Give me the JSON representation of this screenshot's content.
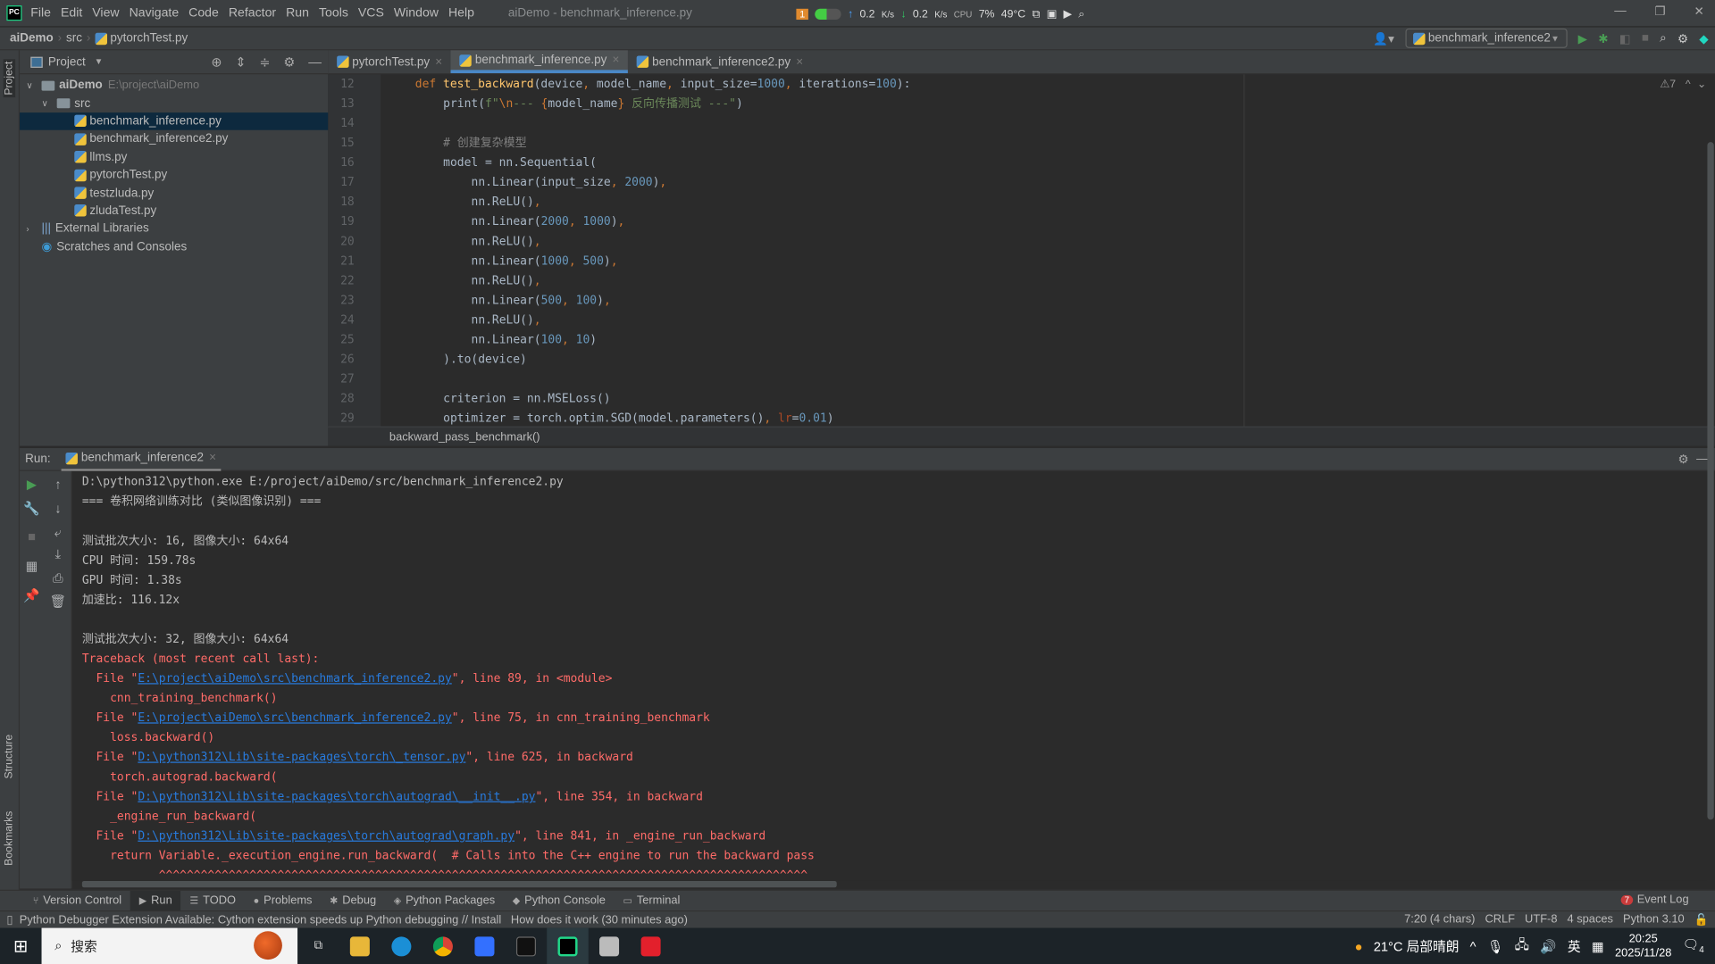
{
  "titlebar": {
    "menu": [
      "File",
      "Edit",
      "View",
      "Navigate",
      "Code",
      "Refactor",
      "Run",
      "Tools",
      "VCS",
      "Window",
      "Help"
    ],
    "title": "aiDemo - benchmark_inference.py",
    "overlay": {
      "badge": "1",
      "up": "0.2",
      "up_unit": "K/s",
      "down": "0.2",
      "down_unit": "K/s",
      "cpu_label": "CPU",
      "cpu": "7%",
      "temp": "49°C"
    }
  },
  "navbar": {
    "breadcrumb": [
      "aiDemo",
      "src",
      "pytorchTest.py"
    ],
    "run_config": "benchmark_inference2"
  },
  "project": {
    "title": "Project",
    "root": "aiDemo",
    "root_path": "E:\\project\\aiDemo",
    "src": "src",
    "files": [
      "benchmark_inference.py",
      "benchmark_inference2.py",
      "llms.py",
      "pytorchTest.py",
      "testzluda.py",
      "zludaTest.py"
    ],
    "selected": "benchmark_inference.py",
    "external": "External Libraries",
    "scratches": "Scratches and Consoles"
  },
  "tabs": [
    {
      "label": "pytorchTest.py",
      "active": false
    },
    {
      "label": "benchmark_inference.py",
      "active": true
    },
    {
      "label": "benchmark_inference2.py",
      "active": false
    }
  ],
  "editor": {
    "warnings": "7",
    "breadcrumb": "backward_pass_benchmark()",
    "lines": [
      {
        "n": "12",
        "indent": 4,
        "seg": [
          [
            "def ",
            "kw"
          ],
          [
            "test_backward",
            "fn"
          ],
          [
            "(device",
            "plain"
          ],
          [
            ", ",
            "kw"
          ],
          [
            "model_name",
            "plain"
          ],
          [
            ", ",
            "kw"
          ],
          [
            "input_size=",
            "plain"
          ],
          [
            "1000",
            "num"
          ],
          [
            ", ",
            "kw"
          ],
          [
            "iterations=",
            "plain"
          ],
          [
            "100",
            "num"
          ],
          [
            "):",
            "plain"
          ]
        ]
      },
      {
        "n": "13",
        "indent": 8,
        "seg": [
          [
            "print",
            "plain"
          ],
          [
            "(",
            "plain"
          ],
          [
            "f\"",
            "str"
          ],
          [
            "\\n",
            "esc"
          ],
          [
            "--- ",
            "str"
          ],
          [
            "{",
            "kw"
          ],
          [
            "model_name",
            "plain"
          ],
          [
            "}",
            "kw"
          ],
          [
            " 反向传播测试 ---\"",
            "str"
          ],
          [
            ")",
            "plain"
          ]
        ]
      },
      {
        "n": "14",
        "indent": 0,
        "seg": []
      },
      {
        "n": "15",
        "indent": 8,
        "seg": [
          [
            "# 创建复杂模型",
            "cm"
          ]
        ]
      },
      {
        "n": "16",
        "indent": 8,
        "seg": [
          [
            "model = nn.Sequential(",
            "plain"
          ]
        ]
      },
      {
        "n": "17",
        "indent": 12,
        "seg": [
          [
            "nn.Linear(input_size",
            "plain"
          ],
          [
            ", ",
            "kw"
          ],
          [
            "2000",
            "num"
          ],
          [
            ")",
            "plain"
          ],
          [
            ",",
            "kw"
          ]
        ]
      },
      {
        "n": "18",
        "indent": 12,
        "seg": [
          [
            "nn.ReLU()",
            "plain"
          ],
          [
            ",",
            "kw"
          ]
        ]
      },
      {
        "n": "19",
        "indent": 12,
        "seg": [
          [
            "nn.Linear(",
            "plain"
          ],
          [
            "2000",
            "num"
          ],
          [
            ", ",
            "kw"
          ],
          [
            "1000",
            "num"
          ],
          [
            ")",
            "plain"
          ],
          [
            ",",
            "kw"
          ]
        ]
      },
      {
        "n": "20",
        "indent": 12,
        "seg": [
          [
            "nn.ReLU()",
            "plain"
          ],
          [
            ",",
            "kw"
          ]
        ]
      },
      {
        "n": "21",
        "indent": 12,
        "seg": [
          [
            "nn.Linear(",
            "plain"
          ],
          [
            "1000",
            "num"
          ],
          [
            ", ",
            "kw"
          ],
          [
            "500",
            "num"
          ],
          [
            ")",
            "plain"
          ],
          [
            ",",
            "kw"
          ]
        ]
      },
      {
        "n": "22",
        "indent": 12,
        "seg": [
          [
            "nn.ReLU()",
            "plain"
          ],
          [
            ",",
            "kw"
          ]
        ]
      },
      {
        "n": "23",
        "indent": 12,
        "seg": [
          [
            "nn.Linear(",
            "plain"
          ],
          [
            "500",
            "num"
          ],
          [
            ", ",
            "kw"
          ],
          [
            "100",
            "num"
          ],
          [
            ")",
            "plain"
          ],
          [
            ",",
            "kw"
          ]
        ]
      },
      {
        "n": "24",
        "indent": 12,
        "seg": [
          [
            "nn.ReLU()",
            "plain"
          ],
          [
            ",",
            "kw"
          ]
        ]
      },
      {
        "n": "25",
        "indent": 12,
        "seg": [
          [
            "nn.Linear(",
            "plain"
          ],
          [
            "100",
            "num"
          ],
          [
            ", ",
            "kw"
          ],
          [
            "10",
            "num"
          ],
          [
            ")",
            "plain"
          ]
        ]
      },
      {
        "n": "26",
        "indent": 8,
        "seg": [
          [
            ").to(device)",
            "plain"
          ]
        ]
      },
      {
        "n": "27",
        "indent": 0,
        "seg": []
      },
      {
        "n": "28",
        "indent": 8,
        "seg": [
          [
            "criterion = nn.MSELoss()",
            "plain"
          ]
        ]
      },
      {
        "n": "29",
        "indent": 8,
        "seg": [
          [
            "optimizer = torch.optim.SGD(model.parameters()",
            "plain"
          ],
          [
            ", ",
            "kw"
          ],
          [
            "lr",
            "param"
          ],
          [
            "=",
            "plain"
          ],
          [
            "0.01",
            "num"
          ],
          [
            ")",
            "plain"
          ]
        ]
      }
    ]
  },
  "run": {
    "label": "Run:",
    "tab": "benchmark_inference2",
    "console": [
      [
        [
          "D:\\python312\\python.exe E:/project/aiDemo/src/benchmark_inference2.py",
          "cn"
        ]
      ],
      [
        [
          "=== 卷积网络训练对比 (类似图像识别) ===",
          "cn"
        ]
      ],
      [],
      [
        [
          "测试批次大小: 16, 图像大小: 64x64",
          "cn"
        ]
      ],
      [
        [
          "CPU 时间: 159.78s",
          "cn"
        ]
      ],
      [
        [
          "GPU 时间: 1.38s",
          "cn"
        ]
      ],
      [
        [
          "加速比: 116.12x",
          "cn"
        ]
      ],
      [],
      [
        [
          "测试批次大小: 32, 图像大小: 64x64",
          "cn"
        ]
      ],
      [
        [
          "Traceback (most recent call last):",
          "ce"
        ]
      ],
      [
        [
          "  File \"",
          "ce"
        ],
        [
          "E:\\project\\aiDemo\\src\\benchmark_inference2.py",
          "cl"
        ],
        [
          "\", line 89, in <module>",
          "ce"
        ]
      ],
      [
        [
          "    cnn_training_benchmark()",
          "ce"
        ]
      ],
      [
        [
          "  File \"",
          "ce"
        ],
        [
          "E:\\project\\aiDemo\\src\\benchmark_inference2.py",
          "cl"
        ],
        [
          "\", line 75, in cnn_training_benchmark",
          "ce"
        ]
      ],
      [
        [
          "    loss.backward()",
          "ce"
        ]
      ],
      [
        [
          "  File \"",
          "ce"
        ],
        [
          "D:\\python312\\Lib\\site-packages\\torch\\_tensor.py",
          "cl"
        ],
        [
          "\", line 625, in backward",
          "ce"
        ]
      ],
      [
        [
          "    torch.autograd.backward(",
          "ce"
        ]
      ],
      [
        [
          "  File \"",
          "ce"
        ],
        [
          "D:\\python312\\Lib\\site-packages\\torch\\autograd\\__init__.py",
          "cl"
        ],
        [
          "\", line 354, in backward",
          "ce"
        ]
      ],
      [
        [
          "    _engine_run_backward(",
          "ce"
        ]
      ],
      [
        [
          "  File \"",
          "ce"
        ],
        [
          "D:\\python312\\Lib\\site-packages\\torch\\autograd\\graph.py",
          "cl"
        ],
        [
          "\", line 841, in _engine_run_backward",
          "ce"
        ]
      ],
      [
        [
          "    return Variable._execution_engine.run_backward(  # Calls into the C++ engine to run the backward pass",
          "ce"
        ]
      ],
      [
        [
          "           ^^^^^^^^^^^^^^^^^^^^^^^^^^^^^^^^^^^^^^^^^^^^^^^^^^^^^^^^^^^^^^^^^^^^^^^^^^^^^^^^^^^^^^^^^^^^^",
          "ce"
        ]
      ]
    ]
  },
  "toolwindows": [
    "Version Control",
    "Run",
    "TODO",
    "Problems",
    "Debug",
    "Python Packages",
    "Python Console",
    "Terminal"
  ],
  "event_log": {
    "count": "7",
    "label": "Event Log"
  },
  "status": {
    "message": "Python Debugger Extension Available: Cython extension speeds up Python debugging // Install   How does it work (30 minutes ago)",
    "position": "7:20 (4 chars)",
    "line_sep": "CRLF",
    "encoding": "UTF-8",
    "indent": "4 spaces",
    "interpreter": "Python 3.10"
  },
  "taskbar": {
    "search": "搜索",
    "weather": "21°C 局部晴朗",
    "ime": "英",
    "time": "20:25",
    "date": "2025/11/28",
    "notifications": "4"
  },
  "colors": {
    "accent": "#4a88c7",
    "error": "#ff6b68",
    "link": "#287bde",
    "selection": "#0d293e"
  }
}
